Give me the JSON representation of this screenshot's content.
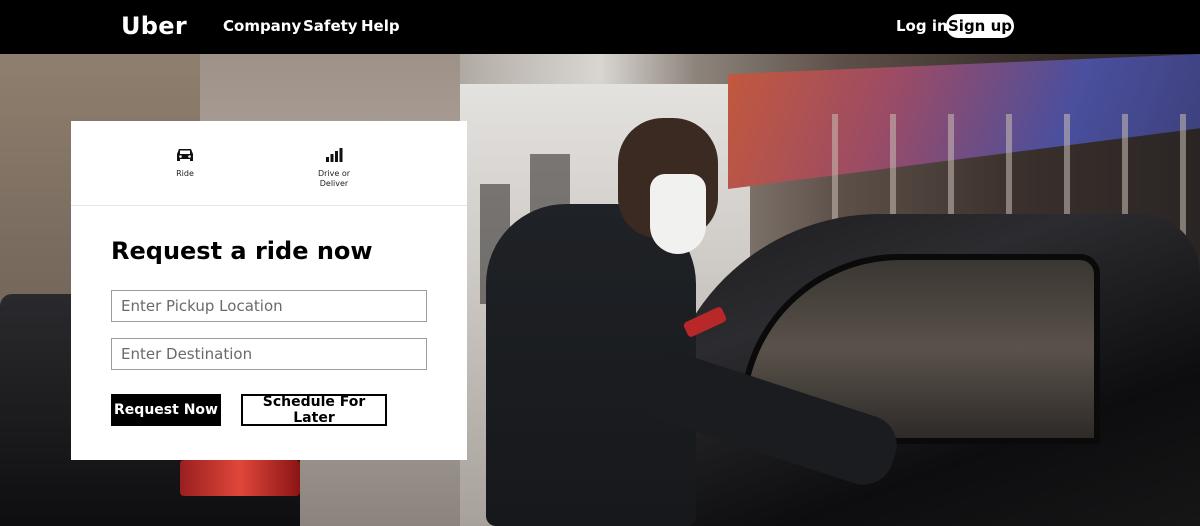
{
  "nav": {
    "logo": "Uber",
    "links": [
      "Company",
      "Safety",
      "Help"
    ],
    "login": "Log in",
    "signup": "Sign up"
  },
  "card": {
    "tabs": [
      {
        "label": "Ride",
        "icon": "car-icon"
      },
      {
        "label": "Drive or Deliver",
        "icon": "signal-bars-icon"
      }
    ],
    "title": "Request a ride now",
    "pickup_placeholder": "Enter Pickup Location",
    "destination_placeholder": "Enter Destination",
    "request_button": "Request Now",
    "schedule_button": "Schedule For Later"
  }
}
